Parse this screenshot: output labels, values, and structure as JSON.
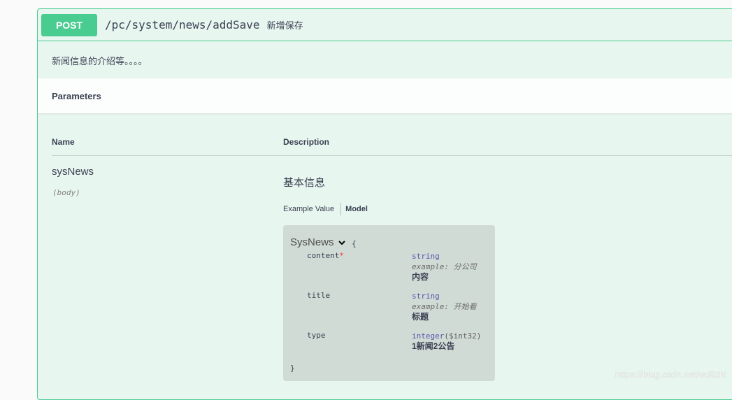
{
  "operation": {
    "method": "POST",
    "path": "/pc/system/news/addSave",
    "summary": "新增保存",
    "description": "新闻信息的介绍等。。。。"
  },
  "parameters_section": {
    "title": "Parameters",
    "col_name": "Name",
    "col_description": "Description",
    "param": {
      "name": "sysNews",
      "in": "(body)",
      "description": "基本信息",
      "tabs": {
        "example": "Example Value",
        "model": "Model"
      },
      "model": {
        "name": "SysNews",
        "open_brace": "{",
        "close_brace": "}",
        "properties": [
          {
            "name": "content",
            "required": "*",
            "type": "string",
            "format": "",
            "example": "example: 分公司",
            "desc": "内容"
          },
          {
            "name": "title",
            "required": "",
            "type": "string",
            "format": "",
            "example": "example: 开始看",
            "desc": "标题"
          },
          {
            "name": "type",
            "required": "",
            "type": "integer",
            "format": "($int32)",
            "example": "",
            "desc": "1新闻2公告"
          }
        ]
      }
    }
  },
  "watermark": "https://blog.csdn.net/wdlizhi",
  "colors": {
    "accent": "#49cc90",
    "background": "#e8f6f0",
    "model_bg": "#d0dbd6"
  }
}
